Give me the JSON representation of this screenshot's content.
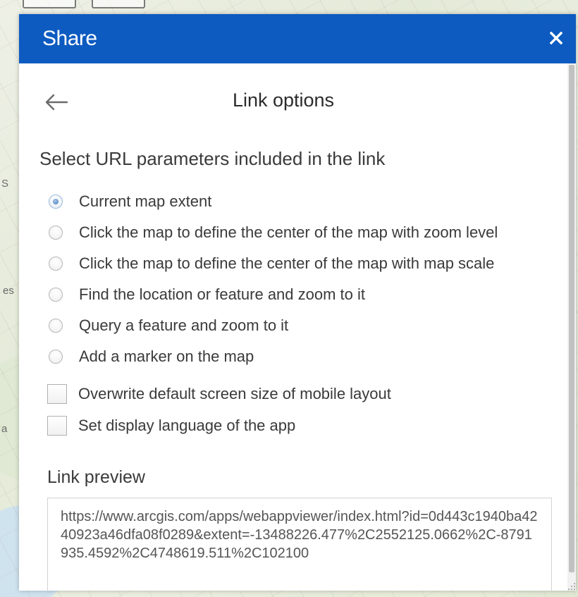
{
  "map": {
    "labels": [
      "es",
      "S",
      "a"
    ]
  },
  "dialog": {
    "title": "Share",
    "close_icon": "close-icon",
    "header_color": "#0d5bc1"
  },
  "link_options": {
    "back_icon": "arrow-left-icon",
    "title": "Link options",
    "section_title": "Select URL parameters included in the link",
    "radio_options": [
      {
        "label": "Current map extent",
        "checked": true
      },
      {
        "label": "Click the map to define the center of the map with zoom level",
        "checked": false
      },
      {
        "label": "Click the map to define the center of the map with map scale",
        "checked": false
      },
      {
        "label": "Find the location or feature and zoom to it",
        "checked": false
      },
      {
        "label": "Query a feature and zoom to it",
        "checked": false
      },
      {
        "label": "Add a marker on the map",
        "checked": false
      }
    ],
    "checkbox_options": [
      {
        "label": "Overwrite default screen size of mobile layout",
        "checked": false
      },
      {
        "label": "Set display language of the app",
        "checked": false
      }
    ],
    "preview_title": "Link preview",
    "preview_url": "https://www.arcgis.com/apps/webappviewer/index.html?id=0d443c1940ba4240923a46dfa08f0289&extent=-13488226.477%2C2552125.0662%2C-8791935.4592%2C4748619.511%2C102100"
  }
}
